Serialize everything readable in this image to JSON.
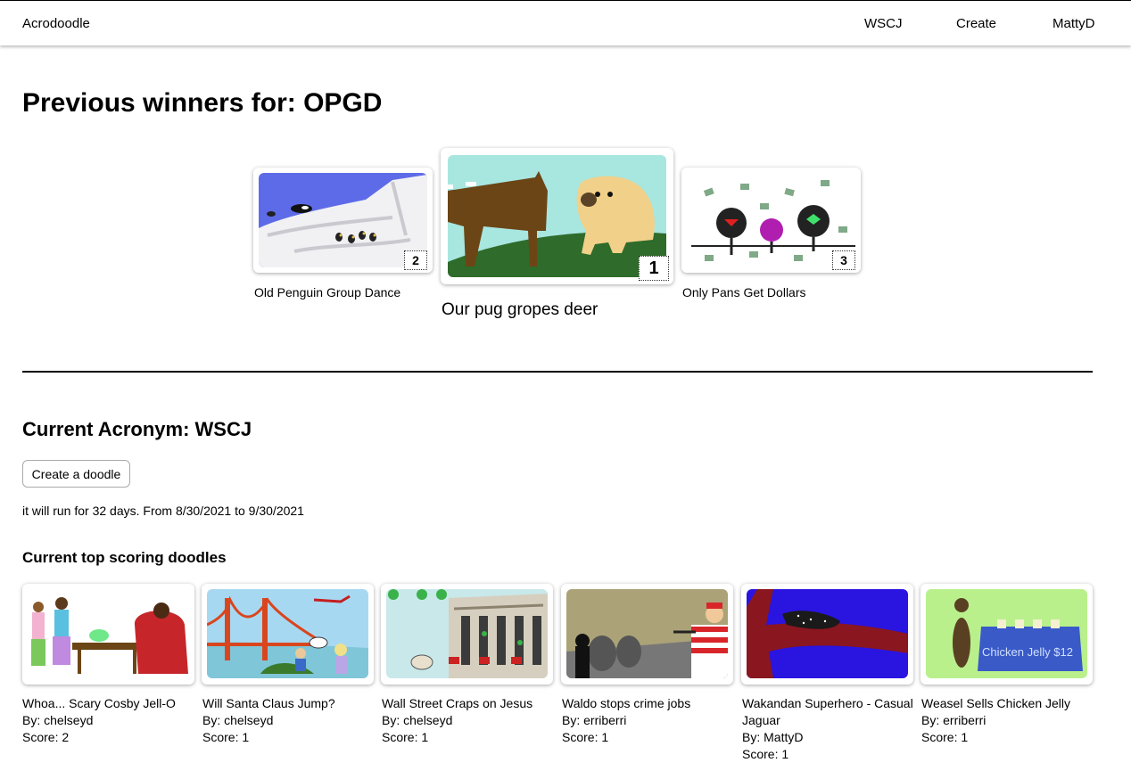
{
  "app": {
    "brand": "Acrodoodle"
  },
  "nav": {
    "links": [
      "WSCJ",
      "Create",
      "MattyD"
    ]
  },
  "previous": {
    "heading": "Previous winners for: OPGD",
    "winners": [
      {
        "rank": "1",
        "title": "Our pug gropes deer"
      },
      {
        "rank": "2",
        "title": "Old Penguin Group Dance"
      },
      {
        "rank": "3",
        "title": "Only Pans Get Dollars"
      }
    ]
  },
  "current": {
    "heading": "Current Acronym: WSCJ",
    "create_button": "Create a doodle",
    "run_info": "it will run for 32 days. From 8/30/2021 to 9/30/2021",
    "top_heading": "Current top scoring doodles",
    "doodles": [
      {
        "title": "Whoa... Scary Cosby Jell-O",
        "by": "By: chelseyd",
        "score": "Score: 2"
      },
      {
        "title": "Will Santa Claus Jump?",
        "by": "By: chelseyd",
        "score": "Score: 1"
      },
      {
        "title": "Wall Street Craps on Jesus",
        "by": "By: chelseyd",
        "score": "Score: 1"
      },
      {
        "title": "Waldo stops crime jobs",
        "by": "By: erriberri",
        "score": "Score: 1"
      },
      {
        "title": "Wakandan Superhero - Casual Jaguar",
        "by": "By: MattyD",
        "score": "Score: 1"
      },
      {
        "title": "Weasel Sells Chicken Jelly",
        "by": "By: erriberri",
        "score": "Score: 1"
      }
    ]
  },
  "drawn_text": {
    "chicken_jelly_sign": "Chicken Jelly $12"
  }
}
